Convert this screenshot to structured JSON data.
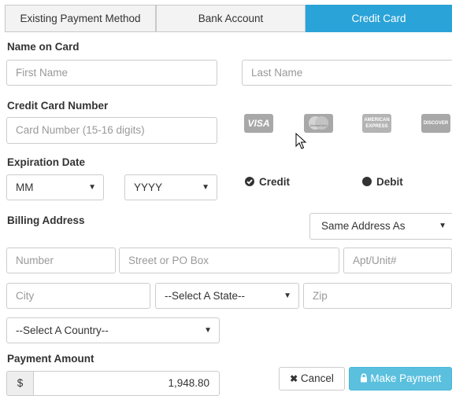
{
  "tabs": [
    {
      "label": "Existing Payment Method",
      "active": false
    },
    {
      "label": "Bank Account",
      "active": false
    },
    {
      "label": "Credit Card",
      "active": true
    }
  ],
  "name_section": {
    "label": "Name on Card",
    "first_placeholder": "First Name",
    "last_placeholder": "Last Name"
  },
  "card_section": {
    "label": "Credit Card Number",
    "number_placeholder": "Card Number (15-16 digits)",
    "card_icons": [
      "visa-icon",
      "mastercard-icon",
      "american-express-icon",
      "discover-icon"
    ],
    "visa_text": "VISA",
    "mastercard_text": "MasterCard",
    "amex_text": "AMERICAN EXPRESS",
    "discover_text": "DISCOVER"
  },
  "expiration": {
    "label": "Expiration Date",
    "month_value": "MM",
    "year_value": "YYYY"
  },
  "card_type": {
    "credit_label": "Credit",
    "debit_label": "Debit"
  },
  "billing": {
    "label": "Billing Address",
    "same_address_value": "Same Address As",
    "number_placeholder": "Number",
    "street_placeholder": "Street or PO Box",
    "apt_placeholder": "Apt/Unit#",
    "city_placeholder": "City",
    "state_value": "--Select A State--",
    "zip_placeholder": "Zip",
    "country_value": "--Select A Country--"
  },
  "payment": {
    "label": "Payment Amount",
    "currency_symbol": "$",
    "amount_value": "1,948.80"
  },
  "buttons": {
    "cancel_label": "Cancel",
    "submit_label": "Make Payment"
  },
  "colors": {
    "active_tab": "#2aa3d8",
    "submit_button": "#5bc0de"
  }
}
